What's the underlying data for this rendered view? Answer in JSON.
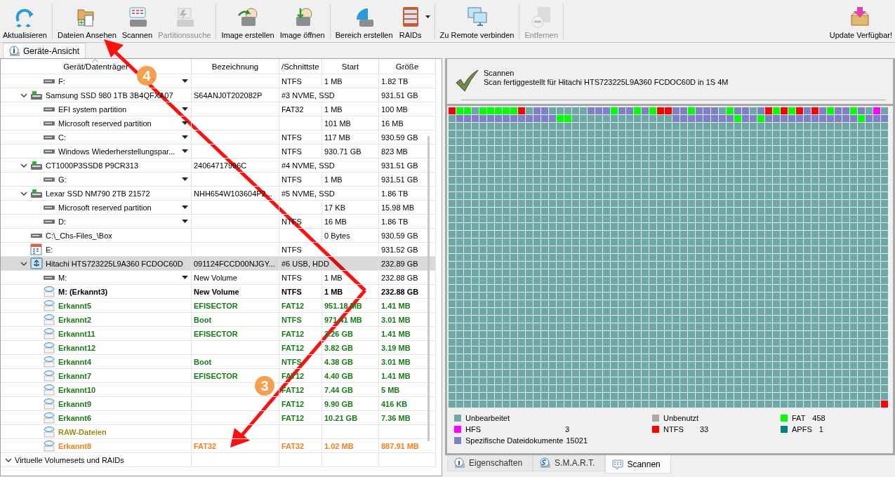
{
  "toolbar": {
    "groups": [
      [
        {
          "label": "Aktualisieren",
          "disabled": false
        }
      ],
      [
        {
          "label": "Dateien Ansehen",
          "disabled": false
        },
        {
          "label": "Scannen",
          "disabled": false
        },
        {
          "label": "Partitionssuche",
          "disabled": true
        }
      ],
      [
        {
          "label": "Image erstellen",
          "disabled": false
        },
        {
          "label": "Image öffnen",
          "disabled": false
        }
      ],
      [
        {
          "label": "Bereich erstellen",
          "disabled": false
        },
        {
          "label": "RAIDs",
          "disabled": false,
          "dropdown": true
        }
      ],
      [
        {
          "label": "Zu Remote verbinden",
          "disabled": false
        }
      ],
      [
        {
          "label": "Entfernen",
          "disabled": true
        }
      ]
    ],
    "update": {
      "label": "Update Verfügbar!"
    }
  },
  "view_tabs": [
    {
      "label": "Geräte-Ansicht",
      "selected": true
    }
  ],
  "table": {
    "columns": [
      "Gerät/Datenträger",
      "Bezeichnung",
      "/Schnittste",
      "Start",
      "Größe"
    ],
    "rows": [
      {
        "kind": "partition",
        "device": "F:",
        "menu": true,
        "selected": false,
        "interface": "NTFS",
        "start": "1 MB",
        "size": "1.82 TB"
      },
      {
        "kind": "ssd",
        "device": "Samsung SSD 980 1TB 3B4QFXA07",
        "label": "S64ANJ0T202082P",
        "interface": "#3 NVME, SSD",
        "size": "931.51 GB",
        "expanded": true,
        "selected": false,
        "children": [
          {
            "kind": "partition",
            "device": "EFI system partition",
            "menu": true,
            "selected": false,
            "interface": "FAT32",
            "start": "1 MB",
            "size": "100 MB"
          },
          {
            "kind": "partition",
            "device": "Microsoft reserved partition",
            "menu": true,
            "selected": false,
            "start": "101 MB",
            "size": "16 MB"
          },
          {
            "kind": "partition",
            "device": "C:",
            "menu": true,
            "selected": false,
            "interface": "NTFS",
            "start": "117 MB",
            "size": "930.59 GB"
          },
          {
            "kind": "partition",
            "device": "Windows Wiederherstellungspar...",
            "menu": true,
            "selected": false,
            "interface": "NTFS",
            "start": "930.71 GB",
            "size": "823 MB"
          }
        ]
      },
      {
        "kind": "ssd",
        "device": "CT1000P3SSD8 P9CR313",
        "label": "24064717996C",
        "interface": "#4 NVME, SSD",
        "size": "931.51 GB",
        "expanded": true,
        "selected": false,
        "children": [
          {
            "kind": "partition",
            "device": "G:",
            "menu": true,
            "selected": false,
            "interface": "NTFS",
            "start": "1 MB",
            "size": "931.51 GB"
          }
        ]
      },
      {
        "kind": "ssd",
        "device": "Lexar SSD NM790 2TB 21572",
        "label": "NHH654W103604P2...",
        "interface": "#5 NVME, SSD",
        "size": "1.86 TB",
        "expanded": true,
        "selected": false,
        "children": [
          {
            "kind": "partition",
            "device": "Microsoft reserved partition",
            "menu": true,
            "selected": false,
            "start": "17 KB",
            "size": "15.98 MB"
          },
          {
            "kind": "partition",
            "device": "D:",
            "menu": true,
            "selected": false,
            "interface": "NTFS",
            "start": "16 MB",
            "size": "1.86 TB"
          }
        ]
      },
      {
        "kind": "volume",
        "device": "C:\\_Chs-Files_\\Box",
        "selected": false,
        "start": "0 Bytes",
        "size": "930.59 GB"
      },
      {
        "kind": "image",
        "device": "E:",
        "selected": false,
        "interface": "NTFS",
        "size": "931.52 GB"
      },
      {
        "kind": "usb-drive",
        "device": "Hitachi HTS723225L9A360 FCDOC60D",
        "label": "091124FCCD00NJGY...",
        "interface": "#6 USB, HDD",
        "size": "232.89 GB",
        "expanded": true,
        "selected": true,
        "children": [
          {
            "kind": "partition",
            "device": "M:",
            "menu": true,
            "selected": false,
            "label": "New Volume",
            "interface": "NTFS",
            "start": "1 MB",
            "size": "232.88 GB"
          },
          {
            "kind": "recovered",
            "device": "M: (Erkannt3)",
            "selected": false,
            "label": "New Volume",
            "interface": "NTFS",
            "start": "1 MB",
            "size": "232.88 GB"
          },
          {
            "kind": "recovered",
            "device": "Erkannt5",
            "color": "#1a7a1a",
            "selected": false,
            "label": "EFISECTOR",
            "interface": "FAT12",
            "start": "951.18 MB",
            "size": "1.41 MB"
          },
          {
            "kind": "recovered",
            "device": "Erkannt2",
            "color": "#1a7a1a",
            "selected": false,
            "label": "Boot",
            "interface": "NTFS",
            "start": "971.41 MB",
            "size": "3.01 MB"
          },
          {
            "kind": "recovered",
            "device": "Erkannt11",
            "color": "#1a7a1a",
            "selected": false,
            "label": "EFISECTOR",
            "interface": "FAT12",
            "start": "3.26 GB",
            "size": "1.41 MB"
          },
          {
            "kind": "recovered",
            "device": "Erkannt12",
            "color": "#1a7a1a",
            "selected": false,
            "interface": "FAT12",
            "start": "3.82 GB",
            "size": "3.19 MB"
          },
          {
            "kind": "recovered",
            "device": "Erkannt4",
            "color": "#1a7a1a",
            "selected": false,
            "label": "Boot",
            "interface": "NTFS",
            "start": "4.38 GB",
            "size": "3.01 MB"
          },
          {
            "kind": "recovered",
            "device": "Erkannt7",
            "color": "#1a7a1a",
            "selected": false,
            "label": "EFISECTOR",
            "interface": "FAT12",
            "start": "4.40 GB",
            "size": "1.41 MB"
          },
          {
            "kind": "recovered",
            "device": "Erkannt10",
            "color": "#1a7a1a",
            "selected": false,
            "interface": "FAT12",
            "start": "7.44 GB",
            "size": "5 MB"
          },
          {
            "kind": "recovered",
            "device": "Erkannt9",
            "color": "#1a7a1a",
            "selected": false,
            "interface": "FAT12",
            "start": "9.90 GB",
            "size": "416 KB"
          },
          {
            "kind": "recovered",
            "device": "Erkannt6",
            "color": "#1a7a1a",
            "selected": false,
            "interface": "FAT12",
            "start": "10.21 GB",
            "size": "7.36 MB"
          },
          {
            "kind": "raw",
            "device": "RAW-Dateien",
            "color": "#9a8a18",
            "selected": false
          },
          {
            "kind": "recovered",
            "device": "Erkannt8",
            "color": "#f58220",
            "selected": false,
            "label": "FAT32",
            "interface": "FAT32",
            "start": "1.02 MB",
            "size": "887.91 MB"
          }
        ]
      },
      {
        "kind": "group",
        "device": "Virtuelle Volumesets und RAIDs",
        "expanded": true,
        "selected": false
      }
    ]
  },
  "scan_status": {
    "title": "Scannen",
    "message": "Scan fertiggestellt für Hitachi HTS723225L9A360 FCDOC60D in 1S 4M"
  },
  "legend": [
    {
      "label": "Unbearbeitet",
      "color": "#6fa8a8"
    },
    {
      "label": "Unbenutzt",
      "color": "#a8a8a8"
    },
    {
      "label": "FAT",
      "count": "458",
      "color": "#00ff00"
    },
    {
      "label": "HFS",
      "count": "3",
      "color": "#ff00ff"
    },
    {
      "label": "NTFS",
      "count": "33",
      "color": "#ff0000"
    },
    {
      "label": "APFS",
      "count": "1",
      "color": "#008080"
    },
    {
      "label": "Spezifische Dateidokumente",
      "count": "15021",
      "color": "#8080c8"
    }
  ],
  "bottom_tabs": [
    {
      "label": "Eigenschaften",
      "selected": false
    },
    {
      "label": "S.M.A.R.T.",
      "selected": false
    },
    {
      "label": "Scannen",
      "selected": true
    }
  ],
  "annotations": [
    {
      "label": "4"
    },
    {
      "label": "3"
    }
  ]
}
